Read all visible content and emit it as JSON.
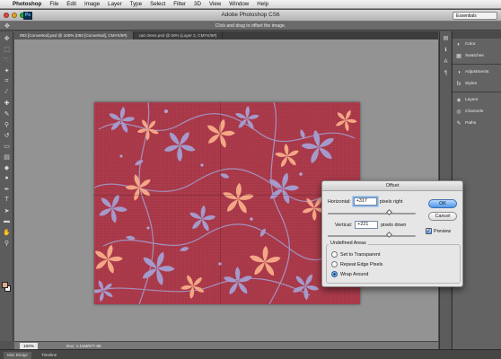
{
  "menubar": {
    "apple_glyph": "",
    "items": [
      "Photoshop",
      "File",
      "Edit",
      "Image",
      "Layer",
      "Type",
      "Select",
      "Filter",
      "3D",
      "View",
      "Window",
      "Help"
    ]
  },
  "window": {
    "title": "Adobe Photoshop CS6",
    "workspace": "Essentials",
    "logo": "Ps"
  },
  "options_bar": {
    "hint": "Click and drag to offset the image."
  },
  "tabs": [
    "093 [Converted].psd @ 100% (093 [Converted], CMYK/8#)",
    "ca0 dress.psd @ 50% (Layer 2, CMYK/8#)"
  ],
  "status": {
    "zoom": "100%",
    "doc": "Doc: 1.11M/977.8K"
  },
  "bottom_tabs": [
    "Mini Bridge",
    "Timeline"
  ],
  "panels": [
    {
      "icon": "color-icon",
      "glyph": "◐",
      "label": "Color"
    },
    {
      "icon": "swatches-icon",
      "glyph": "▦",
      "label": "Swatches"
    },
    {
      "icon": "adjustments-icon",
      "glyph": "◑",
      "label": "Adjustments"
    },
    {
      "icon": "styles-icon",
      "glyph": "fx",
      "label": "Styles"
    },
    {
      "icon": "layers-icon",
      "glyph": "◈",
      "label": "Layers"
    },
    {
      "icon": "channels-icon",
      "glyph": "◎",
      "label": "Channels"
    },
    {
      "icon": "paths-icon",
      "glyph": "✎",
      "label": "Paths"
    }
  ],
  "dialog": {
    "title": "Offset",
    "horizontal_label": "Horizontal:",
    "horizontal_value": "+317",
    "horizontal_unit": "pixels right",
    "vertical_label": "Vertical:",
    "vertical_value": "+221",
    "vertical_unit": "pixels down",
    "ok_label": "OK",
    "cancel_label": "Cancel",
    "preview_label": "Preview",
    "preview_checked": true,
    "undefined_areas_label": "Undefined Areas",
    "options": [
      "Set to Transparent",
      "Repeat Edge Pixels",
      "Wrap Around"
    ],
    "selected_option": "Wrap Around"
  },
  "colors": {
    "canvas_bg": "#a83848",
    "flower_lavender": "#a59acb",
    "flower_peach": "#f4a786",
    "foreground": "#e8a887",
    "ok_button": "#4f97ea"
  }
}
